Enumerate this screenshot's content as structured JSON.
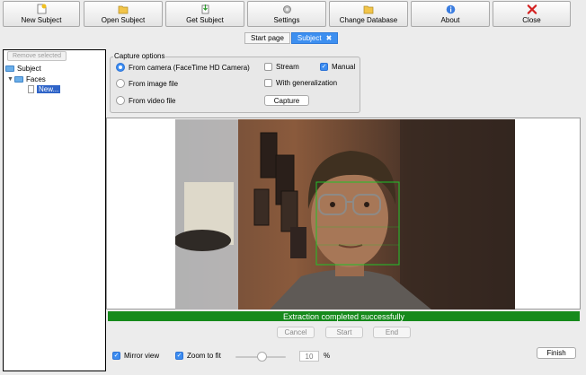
{
  "toolbar": {
    "buttons": [
      {
        "label": "New Subject",
        "icon": "new-document-icon"
      },
      {
        "label": "Open Subject",
        "icon": "open-folder-icon"
      },
      {
        "label": "Get Subject",
        "icon": "get-subject-icon"
      },
      {
        "label": "Settings",
        "icon": "gear-icon"
      },
      {
        "label": "Change Database",
        "icon": "folder-icon"
      },
      {
        "label": "About",
        "icon": "info-icon"
      },
      {
        "label": "Close",
        "icon": "close-icon"
      }
    ]
  },
  "tabs": [
    {
      "label": "Start page"
    },
    {
      "label": "Subject",
      "close": "✖"
    }
  ],
  "left_panel": {
    "remove_label": "Remove selected",
    "tree": {
      "root": "Subject",
      "group": "Faces",
      "item": "New..."
    }
  },
  "capture": {
    "legend": "Capture options",
    "from_camera": "From camera (FaceTime HD Camera)",
    "from_image": "From image file",
    "from_video": "From video file",
    "stream": "Stream",
    "manual": "Manual",
    "with_generalization": "With generalization",
    "capture_button": "Capture"
  },
  "status": "Extraction completed successfully",
  "controls": {
    "cancel": "Cancel",
    "start": "Start",
    "end": "End"
  },
  "bottom": {
    "mirror_view": "Mirror view",
    "zoom_to_fit": "Zoom to fit",
    "zoom_value": "10",
    "percent": "%",
    "finish": "Finish"
  },
  "colors": {
    "accent": "#3c8cf0",
    "status_green": "#168a1c"
  }
}
